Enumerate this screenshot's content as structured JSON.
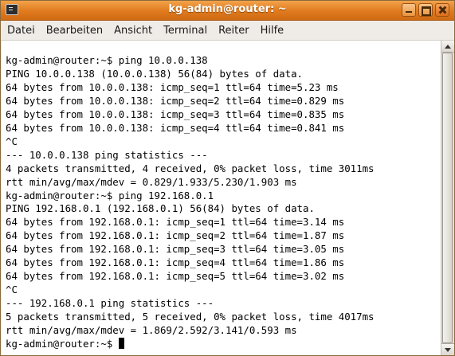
{
  "window": {
    "title": "kg-admin@router: ~"
  },
  "menu": [
    "Datei",
    "Bearbeiten",
    "Ansicht",
    "Terminal",
    "Reiter",
    "Hilfe"
  ],
  "terminal": {
    "lines": [
      "",
      "kg-admin@router:~$ ping 10.0.0.138",
      "PING 10.0.0.138 (10.0.0.138) 56(84) bytes of data.",
      "64 bytes from 10.0.0.138: icmp_seq=1 ttl=64 time=5.23 ms",
      "64 bytes from 10.0.0.138: icmp_seq=2 ttl=64 time=0.829 ms",
      "64 bytes from 10.0.0.138: icmp_seq=3 ttl=64 time=0.835 ms",
      "64 bytes from 10.0.0.138: icmp_seq=4 ttl=64 time=0.841 ms",
      "^C",
      "--- 10.0.0.138 ping statistics ---",
      "4 packets transmitted, 4 received, 0% packet loss, time 3011ms",
      "rtt min/avg/max/mdev = 0.829/1.933/5.230/1.903 ms",
      "kg-admin@router:~$ ping 192.168.0.1",
      "PING 192.168.0.1 (192.168.0.1) 56(84) bytes of data.",
      "64 bytes from 192.168.0.1: icmp_seq=1 ttl=64 time=3.14 ms",
      "64 bytes from 192.168.0.1: icmp_seq=2 ttl=64 time=1.87 ms",
      "64 bytes from 192.168.0.1: icmp_seq=3 ttl=64 time=3.05 ms",
      "64 bytes from 192.168.0.1: icmp_seq=4 ttl=64 time=1.86 ms",
      "64 bytes from 192.168.0.1: icmp_seq=5 ttl=64 time=3.02 ms",
      "^C",
      "--- 192.168.0.1 ping statistics ---",
      "5 packets transmitted, 5 received, 0% packet loss, time 4017ms",
      "rtt min/avg/max/mdev = 1.869/2.592/3.141/0.593 ms"
    ],
    "prompt": "kg-admin@router:~$ "
  },
  "colors": {
    "titlebar": "#e07a1d",
    "menubar": "#efebe7",
    "terminal_bg": "#ffffff",
    "terminal_fg": "#000000"
  },
  "icons": {
    "app": "terminal-icon",
    "minimize": "minimize-icon",
    "maximize": "maximize-icon",
    "close": "close-icon"
  }
}
